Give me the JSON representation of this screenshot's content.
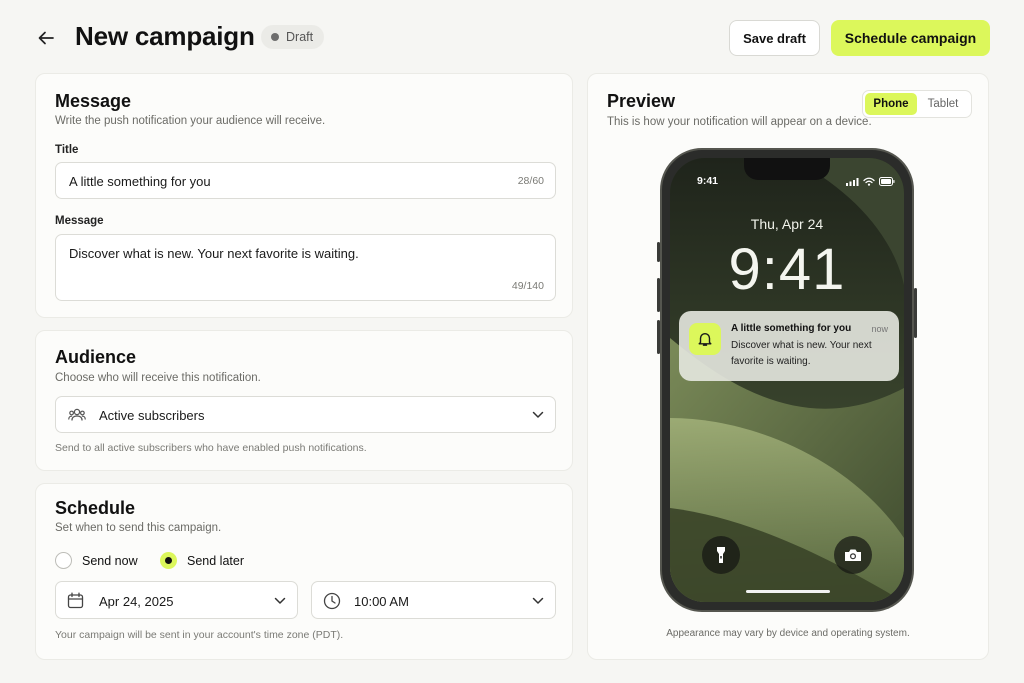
{
  "header": {
    "title": "New campaign",
    "status": "Draft",
    "save_draft": "Save draft",
    "schedule_campaign": "Schedule campaign"
  },
  "message": {
    "heading": "Message",
    "description": "Write the push notification your audience will receive.",
    "title_label": "Title",
    "title_value": "A little something for you",
    "title_counter": "28/60",
    "message_label": "Message",
    "message_value": "Discover what is new. Your next favorite is waiting.",
    "message_counter": "49/140"
  },
  "audience": {
    "heading": "Audience",
    "description": "Choose who will receive this notification.",
    "selected": "Active subscribers",
    "hint": "Send to all active subscribers who have enabled push notifications."
  },
  "schedule": {
    "heading": "Schedule",
    "description": "Set when to send this campaign.",
    "options": [
      "Send now",
      "Send later"
    ],
    "selected_option": "Send later",
    "date": "Apr 24, 2025",
    "time": "10:00 AM",
    "hint": "Your campaign will be sent in your account's time zone (PDT)."
  },
  "preview": {
    "heading": "Preview",
    "description": "This is how your notification will appear on a device.",
    "devices": [
      "Phone",
      "Tablet"
    ],
    "selected_device": "Phone",
    "phone": {
      "status_time": "9:41",
      "lock_date": "Thu, Apr 24",
      "lock_time": "9:41",
      "notification_title": "A little something for you",
      "notification_time": "now",
      "notification_body": "Discover what is new. Your next favorite is waiting."
    },
    "disclaimer": "Appearance may vary by device and operating system."
  },
  "colors": {
    "accent": "#dcf75b",
    "background": "#f6f6f3",
    "card": "#fcfcfa"
  },
  "icons": [
    "back-arrow-icon",
    "users-icon",
    "chevron-down-icon",
    "calendar-icon",
    "clock-icon",
    "bell-icon",
    "flashlight-icon",
    "camera-icon",
    "signal-icon",
    "wifi-icon",
    "battery-icon"
  ]
}
